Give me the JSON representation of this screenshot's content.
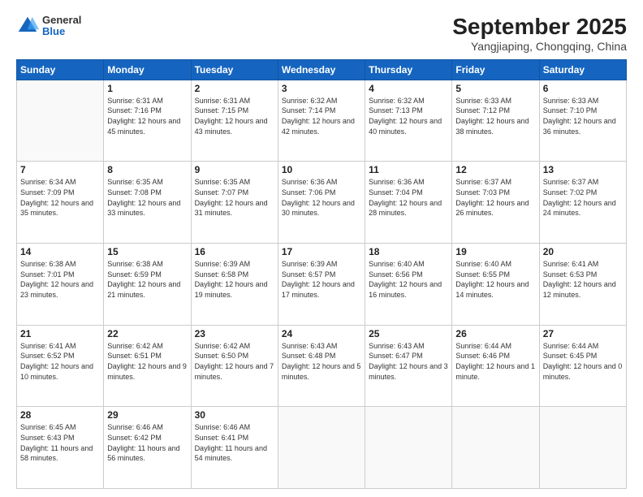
{
  "header": {
    "logo": {
      "line1": "General",
      "line2": "Blue"
    },
    "title": "September 2025",
    "subtitle": "Yangjiaping, Chongqing, China"
  },
  "days_of_week": [
    "Sunday",
    "Monday",
    "Tuesday",
    "Wednesday",
    "Thursday",
    "Friday",
    "Saturday"
  ],
  "weeks": [
    [
      {
        "day": "",
        "empty": true
      },
      {
        "day": "1",
        "sunrise": "6:31 AM",
        "sunset": "7:16 PM",
        "daylight": "12 hours and 45 minutes."
      },
      {
        "day": "2",
        "sunrise": "6:31 AM",
        "sunset": "7:15 PM",
        "daylight": "12 hours and 43 minutes."
      },
      {
        "day": "3",
        "sunrise": "6:32 AM",
        "sunset": "7:14 PM",
        "daylight": "12 hours and 42 minutes."
      },
      {
        "day": "4",
        "sunrise": "6:32 AM",
        "sunset": "7:13 PM",
        "daylight": "12 hours and 40 minutes."
      },
      {
        "day": "5",
        "sunrise": "6:33 AM",
        "sunset": "7:12 PM",
        "daylight": "12 hours and 38 minutes."
      },
      {
        "day": "6",
        "sunrise": "6:33 AM",
        "sunset": "7:10 PM",
        "daylight": "12 hours and 36 minutes."
      }
    ],
    [
      {
        "day": "7",
        "sunrise": "6:34 AM",
        "sunset": "7:09 PM",
        "daylight": "12 hours and 35 minutes."
      },
      {
        "day": "8",
        "sunrise": "6:35 AM",
        "sunset": "7:08 PM",
        "daylight": "12 hours and 33 minutes."
      },
      {
        "day": "9",
        "sunrise": "6:35 AM",
        "sunset": "7:07 PM",
        "daylight": "12 hours and 31 minutes."
      },
      {
        "day": "10",
        "sunrise": "6:36 AM",
        "sunset": "7:06 PM",
        "daylight": "12 hours and 30 minutes."
      },
      {
        "day": "11",
        "sunrise": "6:36 AM",
        "sunset": "7:04 PM",
        "daylight": "12 hours and 28 minutes."
      },
      {
        "day": "12",
        "sunrise": "6:37 AM",
        "sunset": "7:03 PM",
        "daylight": "12 hours and 26 minutes."
      },
      {
        "day": "13",
        "sunrise": "6:37 AM",
        "sunset": "7:02 PM",
        "daylight": "12 hours and 24 minutes."
      }
    ],
    [
      {
        "day": "14",
        "sunrise": "6:38 AM",
        "sunset": "7:01 PM",
        "daylight": "12 hours and 23 minutes."
      },
      {
        "day": "15",
        "sunrise": "6:38 AM",
        "sunset": "6:59 PM",
        "daylight": "12 hours and 21 minutes."
      },
      {
        "day": "16",
        "sunrise": "6:39 AM",
        "sunset": "6:58 PM",
        "daylight": "12 hours and 19 minutes."
      },
      {
        "day": "17",
        "sunrise": "6:39 AM",
        "sunset": "6:57 PM",
        "daylight": "12 hours and 17 minutes."
      },
      {
        "day": "18",
        "sunrise": "6:40 AM",
        "sunset": "6:56 PM",
        "daylight": "12 hours and 16 minutes."
      },
      {
        "day": "19",
        "sunrise": "6:40 AM",
        "sunset": "6:55 PM",
        "daylight": "12 hours and 14 minutes."
      },
      {
        "day": "20",
        "sunrise": "6:41 AM",
        "sunset": "6:53 PM",
        "daylight": "12 hours and 12 minutes."
      }
    ],
    [
      {
        "day": "21",
        "sunrise": "6:41 AM",
        "sunset": "6:52 PM",
        "daylight": "12 hours and 10 minutes."
      },
      {
        "day": "22",
        "sunrise": "6:42 AM",
        "sunset": "6:51 PM",
        "daylight": "12 hours and 9 minutes."
      },
      {
        "day": "23",
        "sunrise": "6:42 AM",
        "sunset": "6:50 PM",
        "daylight": "12 hours and 7 minutes."
      },
      {
        "day": "24",
        "sunrise": "6:43 AM",
        "sunset": "6:48 PM",
        "daylight": "12 hours and 5 minutes."
      },
      {
        "day": "25",
        "sunrise": "6:43 AM",
        "sunset": "6:47 PM",
        "daylight": "12 hours and 3 minutes."
      },
      {
        "day": "26",
        "sunrise": "6:44 AM",
        "sunset": "6:46 PM",
        "daylight": "12 hours and 1 minute."
      },
      {
        "day": "27",
        "sunrise": "6:44 AM",
        "sunset": "6:45 PM",
        "daylight": "12 hours and 0 minutes."
      }
    ],
    [
      {
        "day": "28",
        "sunrise": "6:45 AM",
        "sunset": "6:43 PM",
        "daylight": "11 hours and 58 minutes."
      },
      {
        "day": "29",
        "sunrise": "6:46 AM",
        "sunset": "6:42 PM",
        "daylight": "11 hours and 56 minutes."
      },
      {
        "day": "30",
        "sunrise": "6:46 AM",
        "sunset": "6:41 PM",
        "daylight": "11 hours and 54 minutes."
      },
      {
        "day": "",
        "empty": true
      },
      {
        "day": "",
        "empty": true
      },
      {
        "day": "",
        "empty": true
      },
      {
        "day": "",
        "empty": true
      }
    ]
  ]
}
